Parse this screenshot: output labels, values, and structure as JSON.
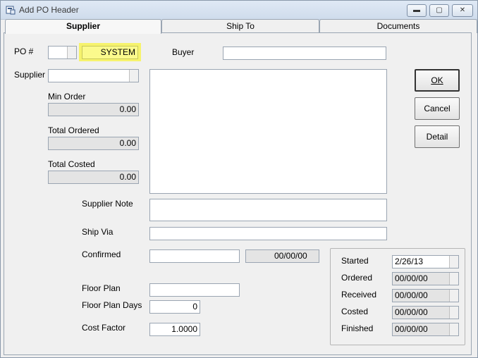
{
  "window": {
    "title": "Add PO Header"
  },
  "tabs": [
    {
      "label": "Supplier",
      "active": true
    },
    {
      "label": "Ship To",
      "active": false
    },
    {
      "label": "Documents",
      "active": false
    }
  ],
  "fields": {
    "po_label": "PO #",
    "po_number": "",
    "po_system": "SYSTEM",
    "buyer_label": "Buyer",
    "buyer_value": "",
    "supplier_label": "Supplier",
    "supplier_value": "",
    "min_order_label": "Min Order",
    "min_order_value": "0.00",
    "total_ordered_label": "Total Ordered",
    "total_ordered_value": "0.00",
    "total_costed_label": "Total Costed",
    "total_costed_value": "0.00",
    "supplier_note_label": "Supplier Note",
    "supplier_note_value": "",
    "ship_via_label": "Ship Via",
    "ship_via_value": "",
    "confirmed_label": "Confirmed",
    "confirmed_value": "",
    "confirmed_date": "00/00/00",
    "floor_plan_label": "Floor Plan",
    "floor_plan_value": "",
    "floor_plan_days_label": "Floor Plan Days",
    "floor_plan_days_value": "0",
    "cost_factor_label": "Cost Factor",
    "cost_factor_value": "1.0000"
  },
  "dates": {
    "started_label": "Started",
    "started_value": "2/26/13",
    "ordered_label": "Ordered",
    "ordered_value": "00/00/00",
    "received_label": "Received",
    "received_value": "00/00/00",
    "costed_label": "Costed",
    "costed_value": "00/00/00",
    "finished_label": "Finished",
    "finished_value": "00/00/00"
  },
  "buttons": {
    "ok": "OK",
    "cancel": "Cancel",
    "detail": "Detail"
  },
  "titlebar_buttons": {
    "minimize": "▬",
    "maximize": "▢",
    "close": "✕"
  },
  "colors": {
    "highlight": "#f6f36d"
  }
}
